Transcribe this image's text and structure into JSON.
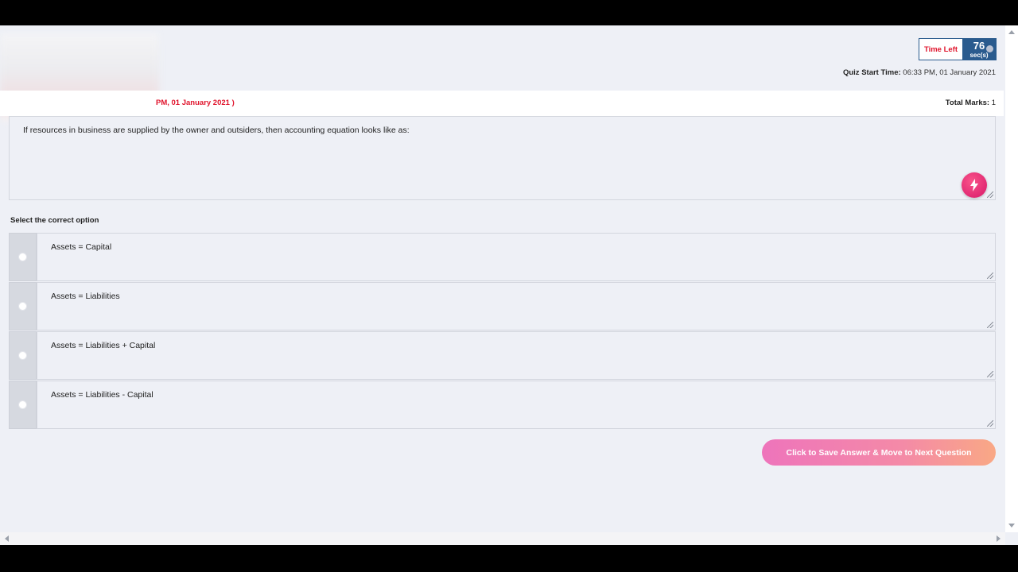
{
  "timer": {
    "label": "Time Left",
    "value": "76",
    "unit": "sec(s)"
  },
  "quiz_start": {
    "label": "Quiz Start Time:",
    "value": "06:33 PM, 01 January 2021"
  },
  "header": {
    "partial_date": "PM, 01 January 2021 )",
    "total_marks_label": "Total Marks:",
    "total_marks_value": "1"
  },
  "question": {
    "text": "If resources in business are supplied by the owner and outsiders, then accounting equation looks like as:"
  },
  "select_label": "Select the correct option",
  "options": [
    {
      "label": "Assets = Capital"
    },
    {
      "label": "Assets = Liabilities"
    },
    {
      "label": "Assets = Liabilities + Capital"
    },
    {
      "label": "Assets = Liabilities - Capital"
    }
  ],
  "next_button": {
    "label": "Click to Save Answer & Move to Next Question"
  },
  "icons": {
    "bolt": "lightning-bolt-icon"
  },
  "colors": {
    "accent_red": "#e0142c",
    "timer_blue": "#2a5b8e",
    "button_gradient_start": "#ee74bb",
    "button_gradient_end": "#f9a885"
  }
}
